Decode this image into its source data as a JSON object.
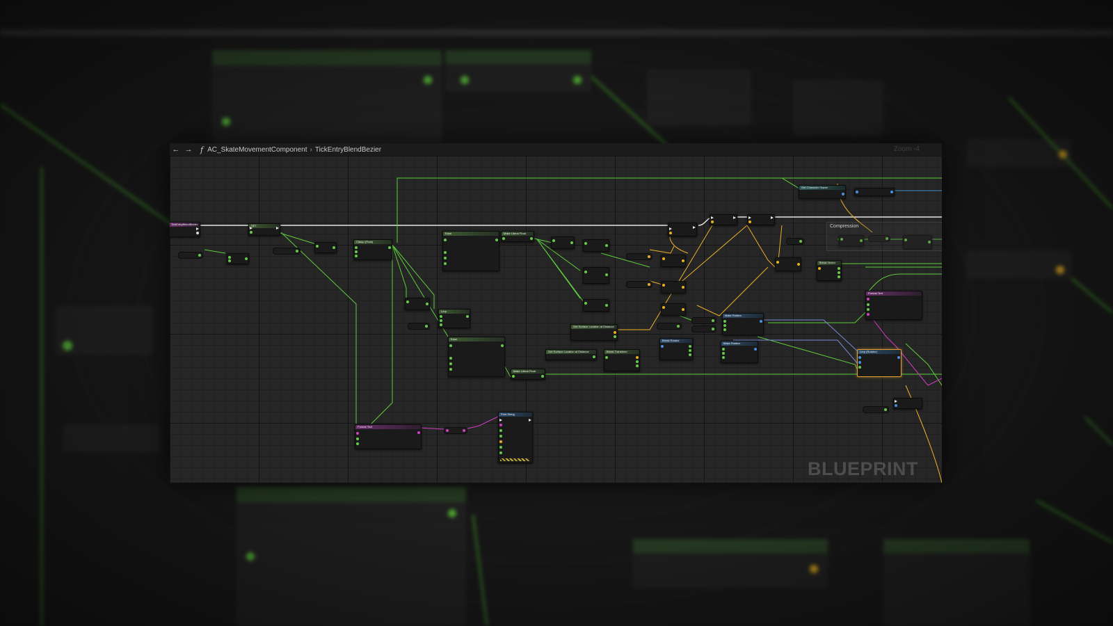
{
  "toolbar": {
    "back_icon": "arrow-left-icon",
    "forward_icon": "arrow-right-icon",
    "function_icon": "function-icon",
    "breadcrumb": [
      "AC_SkateMovementComponent",
      "TickEntryBlendBezier"
    ],
    "zoom": "Zoom -4"
  },
  "graph": {
    "comment_title": "Compression",
    "watermark": "BLUEPRINT"
  },
  "colors": {
    "exec_wire": "#e6e6e6",
    "float_wire": "#5fce3c",
    "vector_wire": "#f0b328",
    "string_wire": "#d63cc4",
    "struct_wire": "#7a8ad8",
    "selected_outline": "#e0a030"
  }
}
